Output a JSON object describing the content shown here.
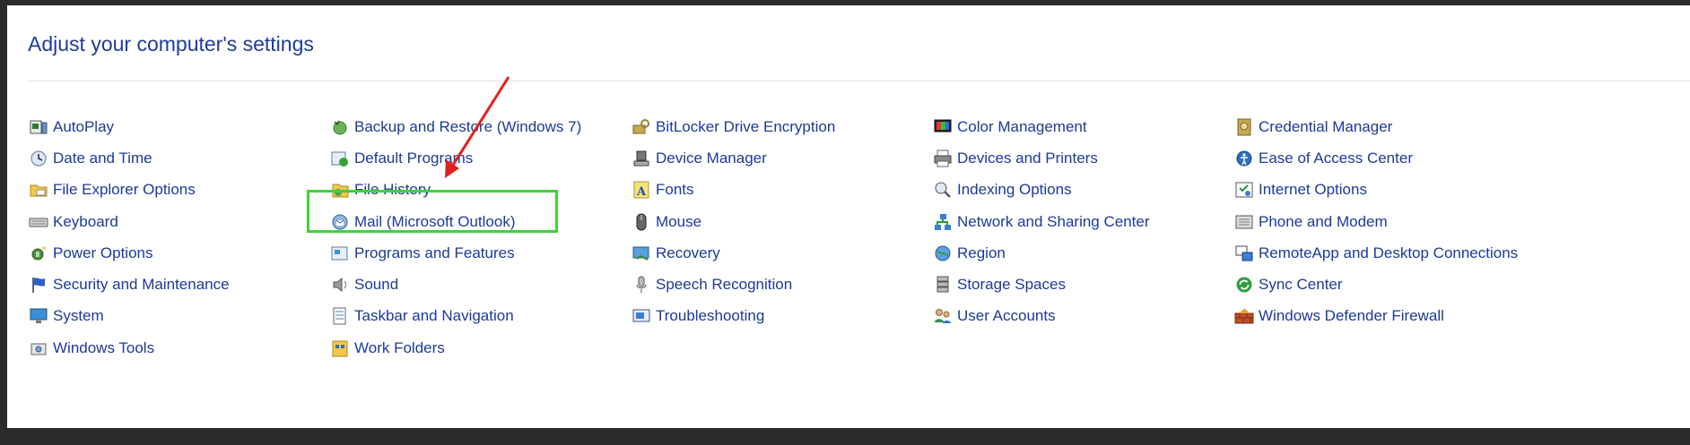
{
  "page_title": "Adjust your computer's settings",
  "colors": {
    "title": "#1e3c9a",
    "link": "#1c3a97",
    "highlight": "#3bd43b",
    "arrow": "#e0201e",
    "frame": "#2b2b2b"
  },
  "columns": [
    [
      {
        "label": "AutoPlay",
        "icon": "autoplay-icon"
      },
      {
        "label": "Date and Time",
        "icon": "clock-icon"
      },
      {
        "label": "File Explorer Options",
        "icon": "folder-options-icon"
      },
      {
        "label": "Keyboard",
        "icon": "keyboard-icon"
      },
      {
        "label": "Power Options",
        "icon": "power-icon"
      },
      {
        "label": "Security and Maintenance",
        "icon": "flag-icon"
      },
      {
        "label": "System",
        "icon": "monitor-icon"
      },
      {
        "label": "Windows Tools",
        "icon": "tools-icon"
      }
    ],
    [
      {
        "label": "Backup and Restore (Windows 7)",
        "icon": "backup-icon"
      },
      {
        "label": "Default Programs",
        "icon": "default-programs-icon"
      },
      {
        "label": "File History",
        "icon": "file-history-icon"
      },
      {
        "label": "Mail (Microsoft Outlook)",
        "icon": "mail-icon"
      },
      {
        "label": "Programs and Features",
        "icon": "programs-icon"
      },
      {
        "label": "Sound",
        "icon": "speaker-icon"
      },
      {
        "label": "Taskbar and Navigation",
        "icon": "taskbar-icon"
      },
      {
        "label": "Work Folders",
        "icon": "work-folders-icon"
      }
    ],
    [
      {
        "label": "BitLocker Drive Encryption",
        "icon": "bitlocker-icon"
      },
      {
        "label": "Device Manager",
        "icon": "device-manager-icon"
      },
      {
        "label": "Fonts",
        "icon": "fonts-icon"
      },
      {
        "label": "Mouse",
        "icon": "mouse-icon"
      },
      {
        "label": "Recovery",
        "icon": "recovery-icon"
      },
      {
        "label": "Speech Recognition",
        "icon": "microphone-icon"
      },
      {
        "label": "Troubleshooting",
        "icon": "troubleshooting-icon"
      }
    ],
    [
      {
        "label": "Color Management",
        "icon": "color-management-icon"
      },
      {
        "label": "Devices and Printers",
        "icon": "printer-icon"
      },
      {
        "label": "Indexing Options",
        "icon": "indexing-icon"
      },
      {
        "label": "Network and Sharing Center",
        "icon": "network-icon"
      },
      {
        "label": "Region",
        "icon": "globe-icon"
      },
      {
        "label": "Storage Spaces",
        "icon": "storage-icon"
      },
      {
        "label": "User Accounts",
        "icon": "users-icon"
      }
    ],
    [
      {
        "label": "Credential Manager",
        "icon": "credential-icon"
      },
      {
        "label": "Ease of Access Center",
        "icon": "ease-of-access-icon"
      },
      {
        "label": "Internet Options",
        "icon": "internet-options-icon"
      },
      {
        "label": "Phone and Modem",
        "icon": "phone-icon"
      },
      {
        "label": "RemoteApp and Desktop Connections",
        "icon": "remoteapp-icon"
      },
      {
        "label": "Sync Center",
        "icon": "sync-icon"
      },
      {
        "label": "Windows Defender Firewall",
        "icon": "firewall-icon"
      }
    ]
  ]
}
